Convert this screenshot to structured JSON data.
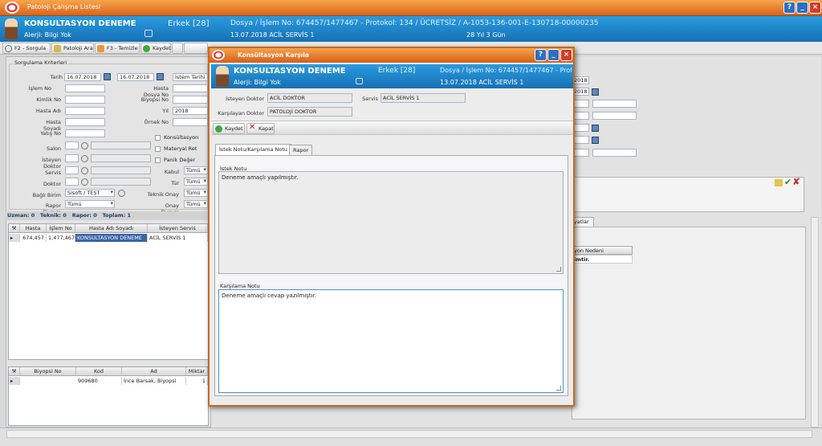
{
  "main": {
    "title": "Patoloji Çalışma Listesi",
    "patient": {
      "name": "KONSULTASYON DENEME",
      "allergy": "Alerji: Bilgi Yok",
      "gender_age": "Erkek [28]",
      "file_info": "Dosya / İşlem No: 674457/1477467 - Protokol: 134 / ÜCRETSİZ / A-1053-136-001-E-130718-00000235",
      "date_service": "13.07.2018 ACİL SERVİS 1",
      "age_detail": "28 Yıl 3 Gün"
    },
    "toolbar": {
      "query": "F2 - Sorgula",
      "search": "Patoloji Ara",
      "clear": "F3 - Temizle",
      "save": "Kaydet"
    },
    "criteria": {
      "group_title": "Sorgulama Kriterleri",
      "date_label": "Tarih",
      "date_from": "16.07.2018",
      "date_to": "16.07.2018",
      "date_type": "İstem Tarihi",
      "islem_no": "İşlem No",
      "hasta_dosya_no": "Hasta Dosya No",
      "kimlik_no": "Kimlik No",
      "biyopsi_no": "Biyopsi No",
      "hasta_adi": "Hasta Adı",
      "yil": "Yıl",
      "yil_value": "2018",
      "hasta_soyadi": "Hasta Soyadı",
      "ornek_no": "Örnek No",
      "yatis_no": "Yatış No",
      "konsultasyon": "Konsültasyon",
      "salon": "Salon",
      "materyal_ret": "Materyal Ret",
      "isteyen_doktor": "İsteyen Doktor",
      "panik_deger": "Panik Değer",
      "servis": "Servis",
      "kabul": "Kabul",
      "kabul_value": "Tümü",
      "doktor": "Doktor",
      "tur": "Tür",
      "tur_value": "Tümü",
      "bagli_birim": "Bağlı Birim",
      "bagli_birim_value": "Sisoft / TEST",
      "teknik_onay": "Teknik Onay",
      "teknik_onay_value": "Tümü",
      "rapor_durum": "Rapor Durum",
      "rapor_durum_value": "Tümü",
      "onay_durum": "Onay Durum",
      "onay_durum_value": "Tümü"
    },
    "counts": {
      "uzman": "Uzman: 0",
      "teknik": "Teknik: 0",
      "rapor": "Rapor: 0",
      "toplam": "Toplam: 1"
    },
    "patient_grid": {
      "headers": [
        "Hasta",
        "İşlem No",
        "Hasta Adı Soyadı",
        "İsteyen Servis"
      ],
      "row": [
        "674,457",
        "1,477,467",
        "KONSULTASYON DENEME",
        "ACİL SERVİS 1"
      ]
    },
    "sample_grid": {
      "headers": [
        "Biyopsi No",
        "Kod",
        "Ad",
        "Miktar"
      ],
      "row": [
        "",
        "909680",
        "İnce Barsak, Biyopsi",
        "1"
      ]
    },
    "right_fragments": {
      "date1": "2018",
      "date2": "2018",
      "tab_fragment": "iyatlar",
      "col_fragment": "yon Nedeni",
      "cell_fragment": "imtir."
    }
  },
  "modal": {
    "title": "Konsültasyon Karşıla",
    "patient": {
      "name": "KONSULTASYON DENEME",
      "allergy": "Alerji: Bilgi Yok",
      "gender_age": "Erkek [28]",
      "file_info": "Dosya / İşlem No: 674457/1477467 - Prot",
      "date_service": "13.07.2018 ACİL SERVİS 1"
    },
    "isteyen_doktor_label": "İsteyen Doktor",
    "isteyen_doktor_value": "ACİL DOKTOR",
    "servis_label": "Servis",
    "servis_value": "ACİL SERVİS 1",
    "karsilayan_doktor_label": "Karşılayan Doktor",
    "karsilayan_doktor_value": "PATOLOJİ DOKTOR",
    "save_label": "Kaydet",
    "close_label": "Kapat",
    "tabs": [
      "İstek Notu/Karşılama Notu",
      "Rapor"
    ],
    "istek_notu_label": "İstek Notu",
    "istek_notu_text": "Deneme amaçlı yapılmıştır.",
    "karsilama_notu_label": "Karşılama Notu",
    "karsilama_notu_text": "Deneme amaçlı cevap yazılmıştır."
  }
}
